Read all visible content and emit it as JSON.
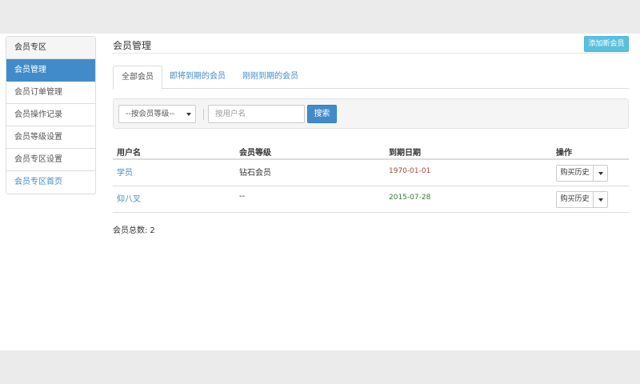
{
  "sidebar": {
    "header": "会员专区",
    "items": [
      {
        "label": "会员管理"
      },
      {
        "label": "会员订单管理"
      },
      {
        "label": "会员操作记录"
      },
      {
        "label": "会员等级设置"
      },
      {
        "label": "会员专区设置"
      },
      {
        "label": "会员专区首页"
      }
    ]
  },
  "header": {
    "title": "会员管理",
    "add_label": "添加新会员"
  },
  "tabs": [
    {
      "label": "全部会员"
    },
    {
      "label": "即将到期的会员"
    },
    {
      "label": "刚刚到期的会员"
    }
  ],
  "filter": {
    "level_select": "--按会员等级--",
    "search_placeholder": "按用户名",
    "search_label": "搜索"
  },
  "table": {
    "columns": [
      "用户名",
      "会员等级",
      "到期日期",
      "操作"
    ],
    "rows": [
      {
        "username": "学员",
        "level": "钻石会员",
        "expiry": "1970-01-01",
        "expiry_color": "#a94442",
        "action": "购买历史"
      },
      {
        "username": "仰八叉",
        "level": "--",
        "expiry": "2015-07-28",
        "expiry_color": "#3c763d",
        "action": "购买历史"
      }
    ]
  },
  "footer": {
    "total_label": "会员总数:",
    "total_value": "2"
  },
  "colors": {
    "primary": "#428bca",
    "info": "#5bc0de"
  }
}
